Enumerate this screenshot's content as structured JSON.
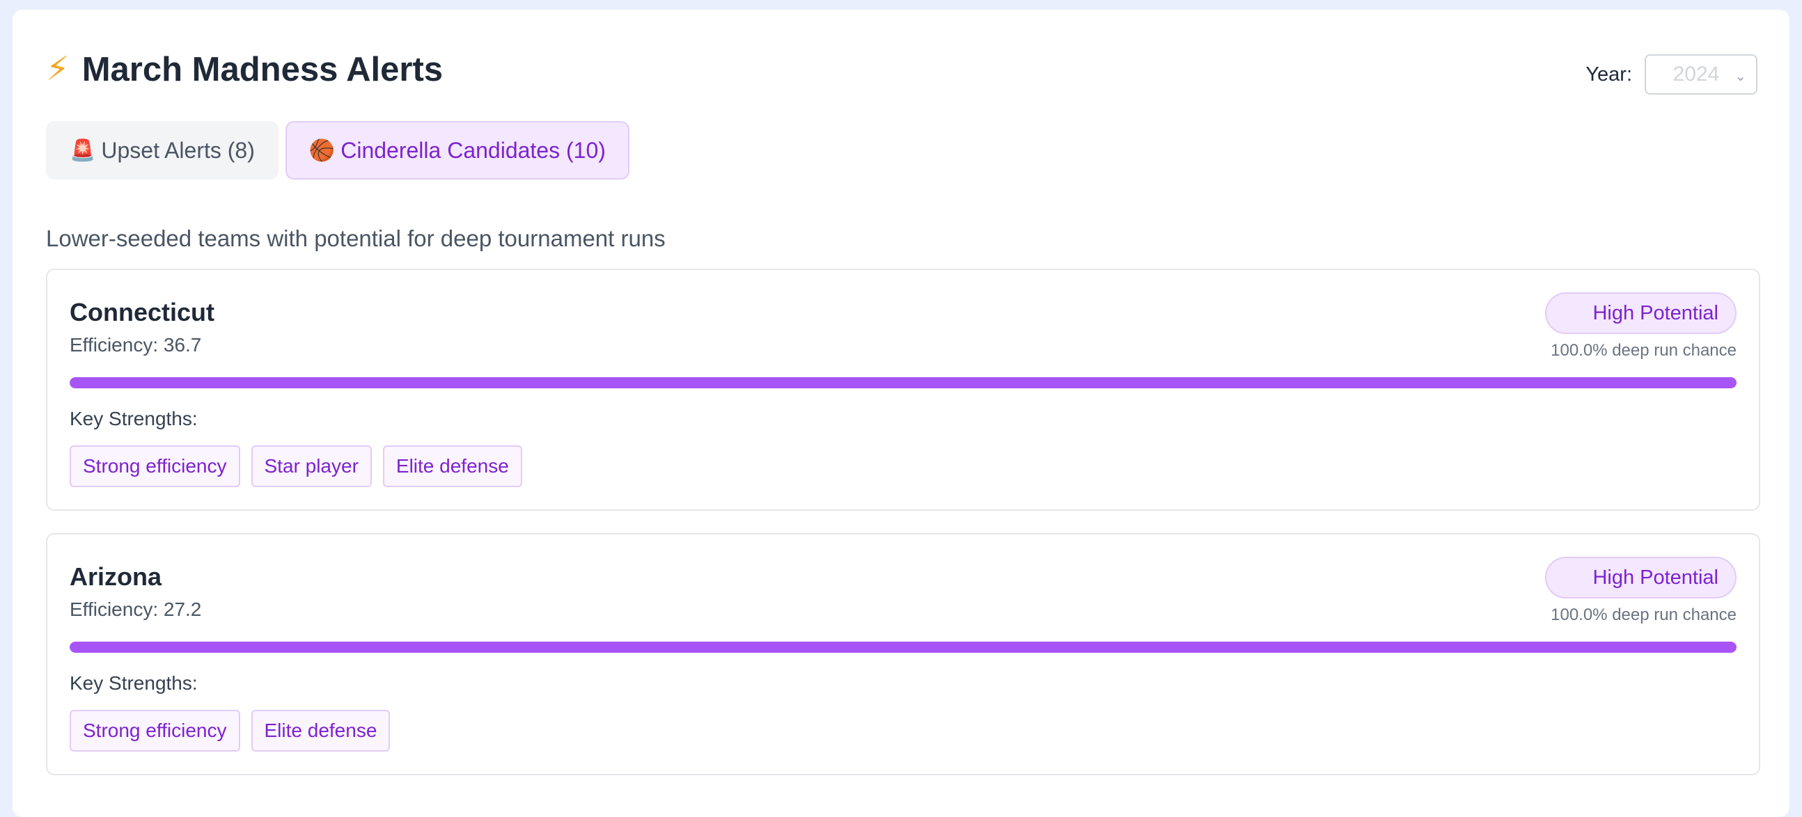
{
  "header": {
    "title_icon": "⚡",
    "title": "March Madness Alerts",
    "year_label": "Year:",
    "year_value": "2024"
  },
  "tabs": [
    {
      "icon": "🚨",
      "label": "Upset Alerts (8)",
      "active": false
    },
    {
      "icon": "🏀",
      "label": "Cinderella Candidates (10)",
      "active": true
    }
  ],
  "subtitle": "Lower-seeded teams with potential for deep tournament runs",
  "colors": {
    "accent": "#a855f7",
    "accent_text": "#7e22ce",
    "accent_bg": "#f3e8ff"
  },
  "teams": [
    {
      "name": "Connecticut",
      "efficiency": "Efficiency: 36.7",
      "badge": "High Potential",
      "chance": "100.0% deep run chance",
      "chance_value": 100,
      "strengths_label": "Key Strengths:",
      "strengths": [
        "Strong efficiency",
        "Star player",
        "Elite defense"
      ]
    },
    {
      "name": "Arizona",
      "efficiency": "Efficiency: 27.2",
      "badge": "High Potential",
      "chance": "100.0% deep run chance",
      "chance_value": 100,
      "strengths_label": "Key Strengths:",
      "strengths": [
        "Strong efficiency",
        "Elite defense"
      ]
    }
  ]
}
